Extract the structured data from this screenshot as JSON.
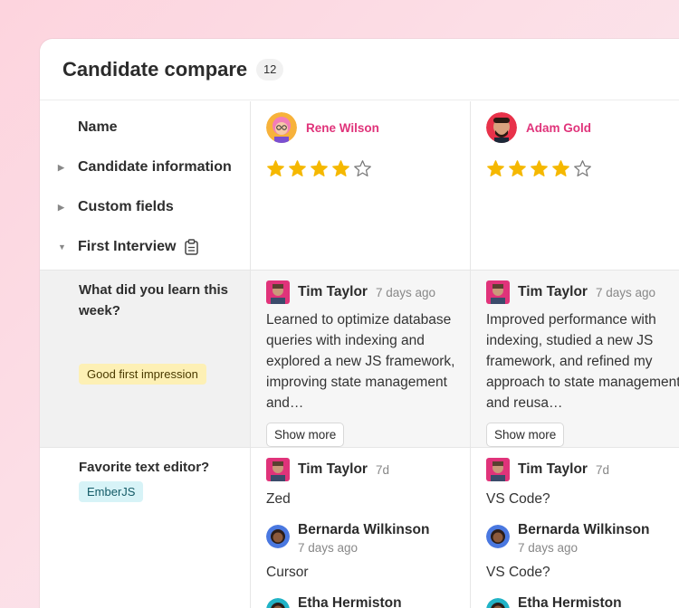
{
  "header": {
    "title": "Candidate compare",
    "count": "12"
  },
  "rows": {
    "name": "Name",
    "candidate_info": "Candidate information",
    "custom_fields": "Custom fields",
    "first_interview": "First Interview"
  },
  "questions": [
    {
      "text": "What did you learn this week?",
      "tag": "Good first impression"
    },
    {
      "text": "Favorite text editor?",
      "tag": "EmberJS"
    }
  ],
  "candidates": [
    {
      "name": "Rene Wilson",
      "rating": 4,
      "rating_max": 5,
      "q1": {
        "author": "Tim Taylor",
        "time": "7 days ago",
        "answer": "Learned to optimize database queries with indexing and explored a new JS framework, improving state management and…",
        "show_more": "Show more"
      },
      "q2": [
        {
          "author": "Tim Taylor",
          "time": "7d",
          "answer": "Zed"
        },
        {
          "author": "Bernarda Wilkinson",
          "time": "7 days ago",
          "answer": "Cursor"
        },
        {
          "author": "Etha Hermiston"
        }
      ]
    },
    {
      "name": "Adam Gold",
      "rating": 4,
      "rating_max": 5,
      "q1": {
        "author": "Tim Taylor",
        "time": "7 days ago",
        "answer": "Improved performance with indexing, studied a new JS framework, and refined my approach to state management and reusa…",
        "show_more": "Show more"
      },
      "q2": [
        {
          "author": "Tim Taylor",
          "time": "7d",
          "answer": "VS Code?"
        },
        {
          "author": "Bernarda Wilkinson",
          "time": "7 days ago",
          "answer": "VS Code?"
        },
        {
          "author": "Etha Hermiston"
        }
      ]
    }
  ],
  "colors": {
    "accent": "#e0337a",
    "star": "#f5b800"
  },
  "icons": {
    "clipboard": "clipboard-icon",
    "caret_right": "caret-right-icon",
    "caret_down": "caret-down-icon"
  }
}
